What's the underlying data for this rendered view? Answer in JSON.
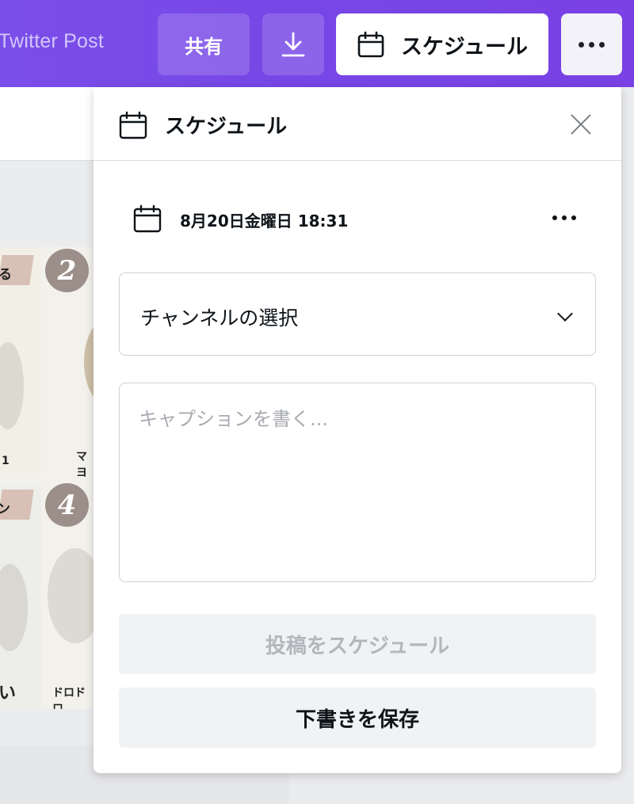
{
  "header": {
    "doc_title": "Twitter Post",
    "share_label": "共有",
    "download_icon": "download-icon",
    "schedule_label": "スケジュール",
    "more_icon": "more-horizontal-icon"
  },
  "background_design": {
    "tile_numbers": [
      "2",
      "4"
    ],
    "text_fragments": [
      "る",
      "1",
      "マヨ",
      "ン",
      "い",
      "ドロドロ"
    ]
  },
  "panel": {
    "title": "スケジュール",
    "date_time": "8月20日金曜日 18:31",
    "channel_select_value": "チャンネルの選択",
    "caption_placeholder": "キャプションを書く...",
    "schedule_post_label": "投稿をスケジュール",
    "save_draft_label": "下書きを保存"
  },
  "colors": {
    "topbar": "#7747e6",
    "disabled_text": "#b3b6bb",
    "border": "#cfd1d5"
  }
}
